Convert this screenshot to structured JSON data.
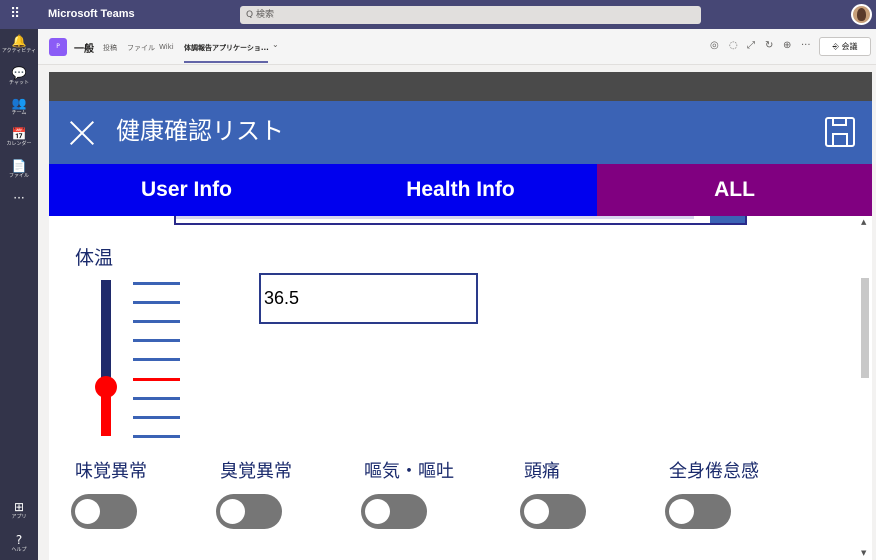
{
  "teams": {
    "app_title": "Microsoft Teams",
    "search_placeholder": "Q 検索",
    "rail": [
      {
        "icon": "bell-icon",
        "glyph": "🔔",
        "label": "アクティビティ"
      },
      {
        "icon": "chat-icon",
        "glyph": "💬",
        "label": "チャット"
      },
      {
        "icon": "teams-icon",
        "glyph": "👥",
        "label": "チーム"
      },
      {
        "icon": "calendar-icon",
        "glyph": "📅",
        "label": "カレンダー"
      },
      {
        "icon": "file-icon",
        "glyph": "📄",
        "label": "ファイル"
      },
      {
        "icon": "more-icon",
        "glyph": "···",
        "label": ""
      },
      {
        "icon": "apps-icon",
        "glyph": "⊞",
        "label": "アプリ"
      },
      {
        "icon": "help-icon",
        "glyph": "?",
        "label": "ヘルプ"
      }
    ],
    "channel": {
      "avatar_letter": "P",
      "name": "一般",
      "tabs": [
        "投稿",
        "ファイル",
        "Wiki",
        "体調報告アプリケーショ..."
      ],
      "active_tab_index": 3,
      "meet_label": "会議"
    }
  },
  "app": {
    "title": "健康確認リスト",
    "tabs": [
      "User Info",
      "Health Info",
      "ALL"
    ],
    "temperature_label": "体温",
    "temperature_value": "36.5",
    "slider_level": 0.3,
    "symptoms": [
      {
        "label": "味覚異常",
        "on": false
      },
      {
        "label": "臭覚異常",
        "on": false
      },
      {
        "label": "嘔気・嘔吐",
        "on": false
      },
      {
        "label": "頭痛",
        "on": false
      },
      {
        "label": "全身倦怠感",
        "on": false
      }
    ]
  }
}
